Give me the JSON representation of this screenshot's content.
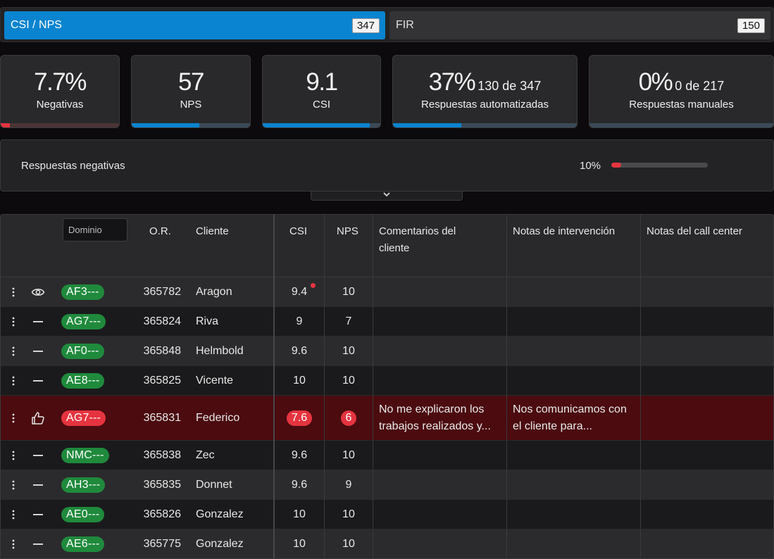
{
  "tabs": [
    {
      "label": "CSI / NPS",
      "count": "347"
    },
    {
      "label": "FIR",
      "count": "150"
    }
  ],
  "kpis": [
    {
      "value": "7.7%",
      "sub": "",
      "label": "Negativas",
      "progress": 0.077,
      "color": "red"
    },
    {
      "value": "57",
      "sub": "",
      "label": "NPS",
      "progress": 0.57,
      "color": "blue"
    },
    {
      "value": "9.1",
      "sub": "",
      "label": "CSI",
      "progress": 0.91,
      "color": "blue"
    },
    {
      "value": "37%",
      "sub": "130 de 347",
      "label": "Respuestas automatizadas",
      "progress": 0.37,
      "color": "blue"
    },
    {
      "value": "0%",
      "sub": "0 de 217",
      "label": "Respuestas manuales",
      "progress": 0.0,
      "color": "blue"
    }
  ],
  "negative_panel": {
    "title": "Respuestas negativas",
    "percent_label": "10%",
    "progress": 0.1
  },
  "table": {
    "filter_placeholder": "Dominio",
    "headers": {
      "or": "O.R.",
      "cliente": "Cliente",
      "csi": "CSI",
      "nps": "NPS",
      "comentarios_l1": "Comentarios del",
      "comentarios_l2": "cliente",
      "notas_intervencion": "Notas de intervención",
      "notas_call_center": "Notas del call center"
    },
    "rows": [
      {
        "status_icon": "eye-icon",
        "dominio": "AF3---",
        "or": "365782",
        "cliente": "Aragon",
        "csi": "9.4",
        "nps": "10",
        "comentario": "",
        "nota": "",
        "negative": false,
        "unread_dot": true
      },
      {
        "status_icon": "dash-icon",
        "dominio": "AG7---",
        "or": "365824",
        "cliente": "Riva",
        "csi": "9",
        "nps": "7",
        "comentario": "",
        "nota": "",
        "negative": false,
        "unread_dot": false
      },
      {
        "status_icon": "dash-icon",
        "dominio": "AF0---",
        "or": "365848",
        "cliente": "Helmbold",
        "csi": "9.6",
        "nps": "10",
        "comentario": "",
        "nota": "",
        "negative": false,
        "unread_dot": false
      },
      {
        "status_icon": "dash-icon",
        "dominio": "AE8---",
        "or": "365825",
        "cliente": "Vicente",
        "csi": "10",
        "nps": "10",
        "comentario": "",
        "nota": "",
        "negative": false,
        "unread_dot": false
      },
      {
        "status_icon": "thumbs-up-icon",
        "dominio": "AG7---",
        "or": "365831",
        "cliente": "Federico",
        "csi": "7.6",
        "nps": "6",
        "comentario": "No me explicaron los trabajos realizados y...",
        "nota": "Nos comunicamos con el cliente para...",
        "negative": true,
        "unread_dot": false
      },
      {
        "status_icon": "dash-icon",
        "dominio": "NMC---",
        "or": "365838",
        "cliente": "Zec",
        "csi": "9.6",
        "nps": "10",
        "comentario": "",
        "nota": "",
        "negative": false,
        "unread_dot": false
      },
      {
        "status_icon": "dash-icon",
        "dominio": "AH3---",
        "or": "365835",
        "cliente": "Donnet",
        "csi": "9.6",
        "nps": "9",
        "comentario": "",
        "nota": "",
        "negative": false,
        "unread_dot": false
      },
      {
        "status_icon": "dash-icon",
        "dominio": "AE0---",
        "or": "365826",
        "cliente": "Gonzalez",
        "csi": "10",
        "nps": "10",
        "comentario": "",
        "nota": "",
        "negative": false,
        "unread_dot": false
      },
      {
        "status_icon": "dash-icon",
        "dominio": "AE6---",
        "or": "365775",
        "cliente": "Gonzalez",
        "csi": "10",
        "nps": "10",
        "comentario": "",
        "nota": "",
        "negative": false,
        "unread_dot": false
      }
    ]
  },
  "colors": {
    "accent": "#0a84d0",
    "negative": "#e5343f",
    "positive": "#1f8a3c"
  }
}
